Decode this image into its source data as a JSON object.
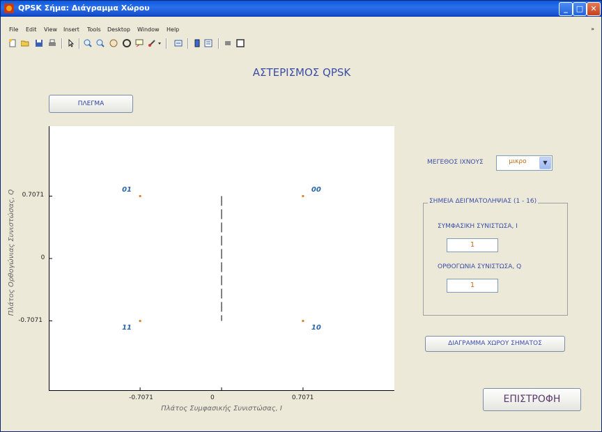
{
  "window": {
    "title": "QPSK Σήμα: Διάγραμμα Χώρου",
    "controls": [
      "minimize",
      "maximize",
      "close"
    ]
  },
  "menu": [
    "File",
    "Edit",
    "View",
    "Insert",
    "Tools",
    "Desktop",
    "Window",
    "Help"
  ],
  "toolbar_icons": [
    "new-file-icon",
    "open-folder-icon",
    "save-icon",
    "print-icon",
    "pointer-icon",
    "zoom-in-icon",
    "zoom-out-icon",
    "pan-icon",
    "rotate-icon",
    "data-cursor-icon",
    "brush-icon",
    "link-plot-icon",
    "colorbar-icon",
    "legend-icon",
    "hide-plot-tools-icon",
    "show-plot-tools-icon"
  ],
  "figure_title": "ΑΣΤΕΡΙΣΜΟΣ QPSK",
  "grid_button": "ΠΛΕΓΜΑ",
  "trace_size": {
    "label": "ΜΕΓΕΘΟΣ ΙΧΝΟΥΣ",
    "selected": "μικρο"
  },
  "samples_panel": {
    "title": "ΣΗΜΕΙΑ ΔΕΙΓΜΑΤΟΛΗΨΙΑΣ (1 - 16)",
    "in_phase_label": "ΣΥΜΦΑΣΙΚΗ ΣΥΝΙΣΤΩΣΑ, Ι",
    "in_phase_value": "1",
    "quadrature_label": "ΟΡΘΟΓΩΝΙΑ ΣΥΝΙΣΤΩΣΑ, Q",
    "quadrature_value": "1"
  },
  "signal_diagram_button": "ΔΙΑΓΡΑΜΜΑ ΧΩΡΟΥ ΣΗΜΑΤΟΣ",
  "back_button": "ΕΠΙΣΤΡΟΦΗ",
  "colors": {
    "marker": "#e07a1f",
    "label": "#2a66a8",
    "title": "#3a4ea8"
  },
  "chart_data": {
    "type": "scatter",
    "title": "",
    "xlabel": "Πλάτος Συμφασικής Συνιστώσας, I",
    "ylabel": "Πλάτος Ορθογώνιας Συνιστώσας, Q",
    "xlim": [
      -1.5,
      1.5
    ],
    "ylim": [
      -1.5,
      1.5
    ],
    "xticks": [
      "-0.7071",
      "0",
      "0.7071"
    ],
    "yticks": [
      "0.7071",
      "0",
      "-0.7071"
    ],
    "grid": false,
    "points": [
      {
        "x": -0.7071,
        "y": 0.7071,
        "label": "01"
      },
      {
        "x": 0.7071,
        "y": 0.7071,
        "label": "00"
      },
      {
        "x": -0.7071,
        "y": -0.7071,
        "label": "11"
      },
      {
        "x": 0.7071,
        "y": -0.7071,
        "label": "10"
      }
    ],
    "decision_line": {
      "x": 0,
      "y": [
        -0.7071,
        0.7071
      ],
      "style": "dashed"
    }
  }
}
